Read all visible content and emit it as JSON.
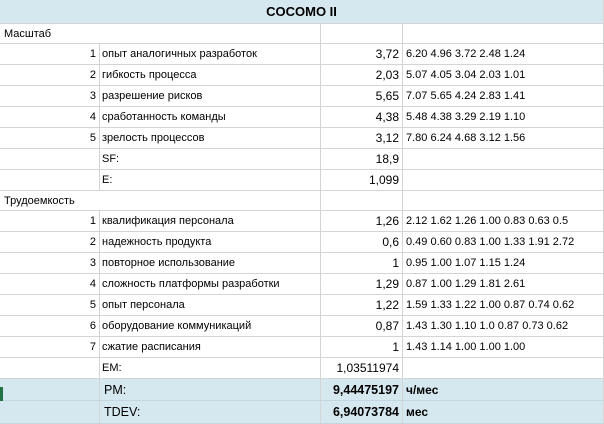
{
  "title": "COCOMO II",
  "scale_section": {
    "label": "Масштаб"
  },
  "scale_factors": [
    {
      "n": "1",
      "name": "опыт аналогичных разработок",
      "value": "3,72",
      "options": "6.20 4.96 3.72 2.48 1.24"
    },
    {
      "n": "2",
      "name": "гибкость процесса",
      "value": "2,03",
      "options": "5.07 4.05 3.04 2.03 1.01"
    },
    {
      "n": "3",
      "name": "разрешение рисков",
      "value": "5,65",
      "options": "7.07 5.65 4.24 2.83 1.41"
    },
    {
      "n": "4",
      "name": "сработанность команды",
      "value": "4,38",
      "options": "5.48 4.38 3.29 2.19 1.10"
    },
    {
      "n": "5",
      "name": "зрелость процессов",
      "value": "3,12",
      "options": "7.80 6.24 4.68 3.12 1.56"
    }
  ],
  "sf": {
    "label": "SF:",
    "value": "18,9"
  },
  "e": {
    "label": "E:",
    "value": "1,099"
  },
  "effort_section": {
    "label": "Трудоемкость"
  },
  "effort_multipliers": [
    {
      "n": "1",
      "name": "квалификация персонала",
      "value": "1,26",
      "options": "2.12 1.62 1.26 1.00 0.83 0.63 0.5"
    },
    {
      "n": "2",
      "name": "надежность продукта",
      "value": "0,6",
      "options": "0.49 0.60 0.83 1.00 1.33 1.91 2.72"
    },
    {
      "n": "3",
      "name": "повторное использование",
      "value": "1",
      "options": "0.95 1.00 1.07 1.15 1.24"
    },
    {
      "n": "4",
      "name": "сложность платформы разработки",
      "value": "1,29",
      "options": "0.87 1.00 1.29 1.81 2.61"
    },
    {
      "n": "5",
      "name": "опыт персонала",
      "value": "1,22",
      "options": "1.59 1.33 1.22 1.00 0.87 0.74 0.62"
    },
    {
      "n": "6",
      "name": "оборудование коммуникаций",
      "value": "0,87",
      "options": "1.43 1.30 1.10 1.0 0.87 0.73 0.62"
    },
    {
      "n": "7",
      "name": "сжатие расписания",
      "value": "1",
      "options": "1.43 1.14 1.00 1.00 1.00"
    }
  ],
  "em": {
    "label": "EM:",
    "value": "1,03511974"
  },
  "pm": {
    "label": "PM:",
    "value": "9,44475197",
    "unit": "ч/мес"
  },
  "tdev": {
    "label": "TDEV:",
    "value": "6,94073784",
    "unit": "мес"
  },
  "colors": {
    "header_bg": "#d6e8ef",
    "grid": "#d4d4d4",
    "active_marker": "#217346"
  }
}
